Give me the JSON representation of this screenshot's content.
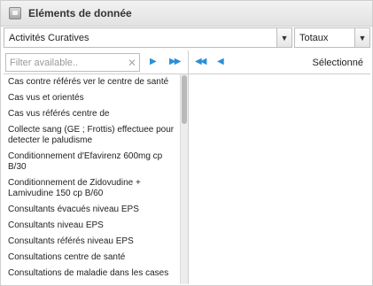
{
  "header": {
    "title": "Eléments de donnée",
    "icon": "dataset-icon"
  },
  "group_select": {
    "value": "Activités Curatives"
  },
  "totals_select": {
    "value": "Totaux"
  },
  "filter": {
    "placeholder": "Filter available.."
  },
  "transfer": {
    "move_selected": "▶",
    "move_all": "▶▶",
    "remove_all": "◀◀",
    "remove_selected": "◀"
  },
  "selected_label": "Sélectionné",
  "available_items": [
    "Cas contre référés ver le centre de santé",
    "Cas vus et orientés",
    "Cas vus référés centre de",
    "Collecte sang (GE ; Frottis) effectuee pour detecter le paludisme",
    "Conditionnement d'Efavirenz 600mg cp B/30",
    "Conditionnement de Zidovudine + Lamivudine 150 cp B/60",
    "Consultants évacués niveau EPS",
    "Consultants niveau EPS",
    "Consultants référés niveau EPS",
    "Consultations centre de santé",
    "Consultations de maladie dans les cases"
  ]
}
